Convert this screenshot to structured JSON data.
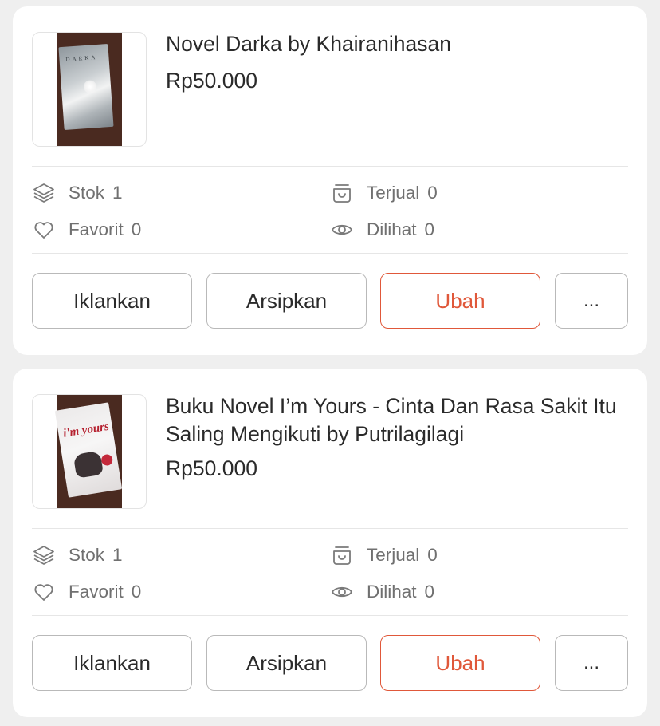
{
  "products": [
    {
      "title": "Novel Darka by Khairanihasan",
      "price": "Rp50.000",
      "thumbnail_text": "DARKA",
      "stats": {
        "stok_label": "Stok",
        "stok_value": "1",
        "terjual_label": "Terjual",
        "terjual_value": "0",
        "favorit_label": "Favorit",
        "favorit_value": "0",
        "dilihat_label": "Dilihat",
        "dilihat_value": "0"
      },
      "actions": {
        "promote": "Iklankan",
        "archive": "Arsipkan",
        "edit": "Ubah",
        "more": "..."
      }
    },
    {
      "title": "Buku Novel I’m Yours - Cinta Dan Rasa Sakit Itu Saling Mengikuti by Putrilagilagi",
      "price": "Rp50.000",
      "thumbnail_text": "i'm yours",
      "stats": {
        "stok_label": "Stok",
        "stok_value": "1",
        "terjual_label": "Terjual",
        "terjual_value": "0",
        "favorit_label": "Favorit",
        "favorit_value": "0",
        "dilihat_label": "Dilihat",
        "dilihat_value": "0"
      },
      "actions": {
        "promote": "Iklankan",
        "archive": "Arsipkan",
        "edit": "Ubah",
        "more": "..."
      }
    }
  ],
  "icons": {
    "stok": "layers-icon",
    "terjual": "basket-icon",
    "favorit": "heart-icon",
    "dilihat": "eye-icon"
  },
  "colors": {
    "accent": "#e0583a",
    "background": "#efefef",
    "card": "#ffffff",
    "muted_text": "#707070"
  }
}
